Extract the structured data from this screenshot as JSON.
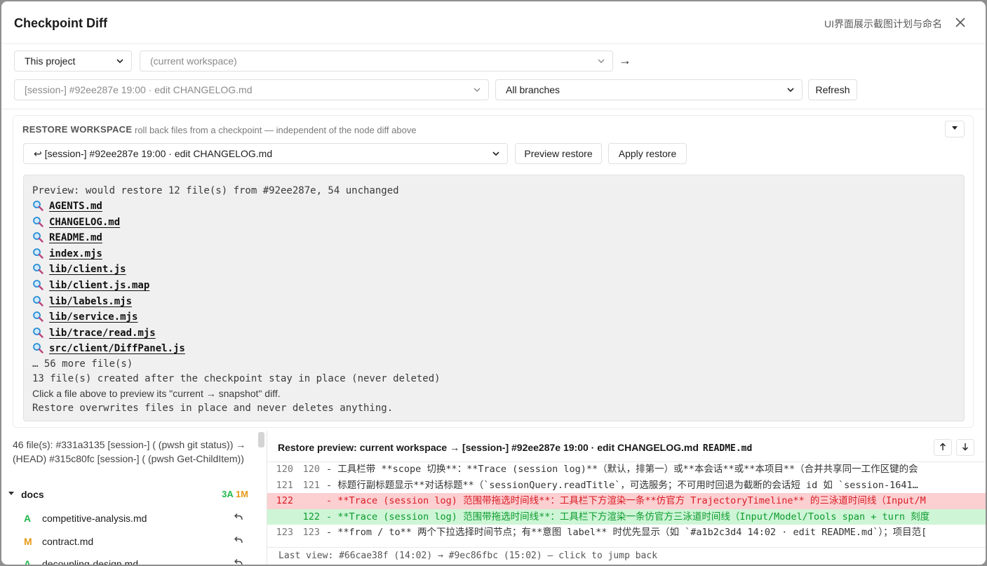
{
  "header": {
    "title": "Checkpoint Diff",
    "subtitle": "UI界面展示截图计划与命名"
  },
  "controls": {
    "scope": "This project",
    "from": "(current workspace)",
    "to": "[session-] #92ee287e 19:00 · edit CHANGELOG.md",
    "branches": "All branches",
    "refresh": "Refresh",
    "arrow": "→"
  },
  "restore": {
    "title": "RESTORE WORKSPACE",
    "description": "roll back files from a checkpoint — independent of the node diff above",
    "checkpoint": "↩ [session-] #92ee287e 19:00 · edit CHANGELOG.md",
    "preview_button": "Preview restore",
    "apply_button": "Apply restore",
    "preview": {
      "summary": "Preview: would restore 12 file(s) from #92ee287e, 54 unchanged",
      "files": [
        "AGENTS.md",
        "CHANGELOG.md",
        "README.md",
        "index.mjs",
        "lib/client.js",
        "lib/client.js.map",
        "lib/labels.mjs",
        "lib/service.mjs",
        "lib/trace/read.mjs",
        "src/client/DiffPanel.js"
      ],
      "more": "… 56 more file(s)",
      "created_note": "13 file(s) created after the checkpoint stay in place (never deleted)",
      "click_hint": "Click a file above to preview its \"current → snapshot\" diff.",
      "overwrite_note": "Restore overwrites files in place and never deletes anything."
    }
  },
  "filelist": {
    "summary": "46 file(s): #331a3135 [session-] ( (pwsh git status)) → (HEAD) #315c80fc [session-] ( (pwsh Get-ChildItem))",
    "folder": {
      "name": "docs",
      "added": "3A",
      "modified": "1M"
    },
    "files": [
      {
        "status": "A",
        "name": "competitive-analysis.md"
      },
      {
        "status": "M",
        "name": "contract.md"
      },
      {
        "status": "A",
        "name": "decoupling-design.md"
      }
    ]
  },
  "diff": {
    "title": "Restore preview: current workspace → [session-] #92ee287e 19:00 · edit CHANGELOG.md",
    "file": "README.md",
    "lines": [
      {
        "kind": "ctx",
        "old": "120",
        "new": "120",
        "text": "- 工具栏带 **scope 切换**：**Trace (session log)**（默认，排第一）或**本会话**或**本项目**（合并共享同一工作区键的会"
      },
      {
        "kind": "ctx",
        "old": "121",
        "new": "121",
        "text": "- 标题行副标题显示**对话标题**（`sessionQuery.readTitle`，可选服务；不可用时回退为截断的会话短 id 如 `session-1641…"
      },
      {
        "kind": "del",
        "old": "122",
        "new": "",
        "text": "- **Trace (session log) 范围带拖选时间线**：工具栏下方渲染一条**仿官方 TrajectoryTimeline** 的三泳道时间线（Input/M"
      },
      {
        "kind": "add",
        "old": "",
        "new": "122",
        "text": "- **Trace (session log) 范围带拖选时间线**：工具栏下方渲染一条仿官方三泳道时间线（Input/Model/Tools span + turn 刻度"
      },
      {
        "kind": "ctx",
        "old": "123",
        "new": "123",
        "text": "- **from / to** 两个下拉选择时间节点；有**意图 label** 时优先显示（如 `#a1b2c3d4 14:02 · edit README.md`）；项目范["
      }
    ],
    "last_view": "Last view: #66cae38f (14:02) → #9ec86fbc (15:02) — click to jump back"
  },
  "colors": {
    "added": "#1fb84a",
    "modified": "#e59a1a",
    "del_bg": "#fccfd1",
    "add_bg": "#cdf5d6"
  }
}
